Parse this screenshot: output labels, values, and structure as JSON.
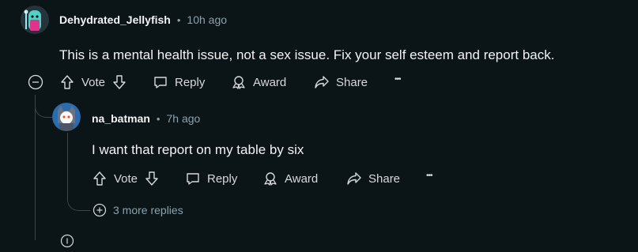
{
  "comment1": {
    "author": "Dehydrated_Jellyfish",
    "separator": "•",
    "time": "10h ago",
    "body": "This is a mental health issue, not a sex issue. Fix your self esteem and report back.",
    "actions": {
      "vote": "Vote",
      "reply": "Reply",
      "award": "Award",
      "share": "Share",
      "more": "•••"
    },
    "collapse_icon": "collapse-minus-icon"
  },
  "comment2": {
    "author": "na_batman",
    "separator": "•",
    "time": "7h ago",
    "body": "I want that report on my table by six",
    "actions": {
      "vote": "Vote",
      "reply": "Reply",
      "award": "Award",
      "share": "Share",
      "more": "•••"
    },
    "more_replies": "3 more replies"
  },
  "colors": {
    "background": "#0b1416",
    "text": "#f2f4f5",
    "muted": "#8ba2ad",
    "thread_line": "#3b4547"
  }
}
